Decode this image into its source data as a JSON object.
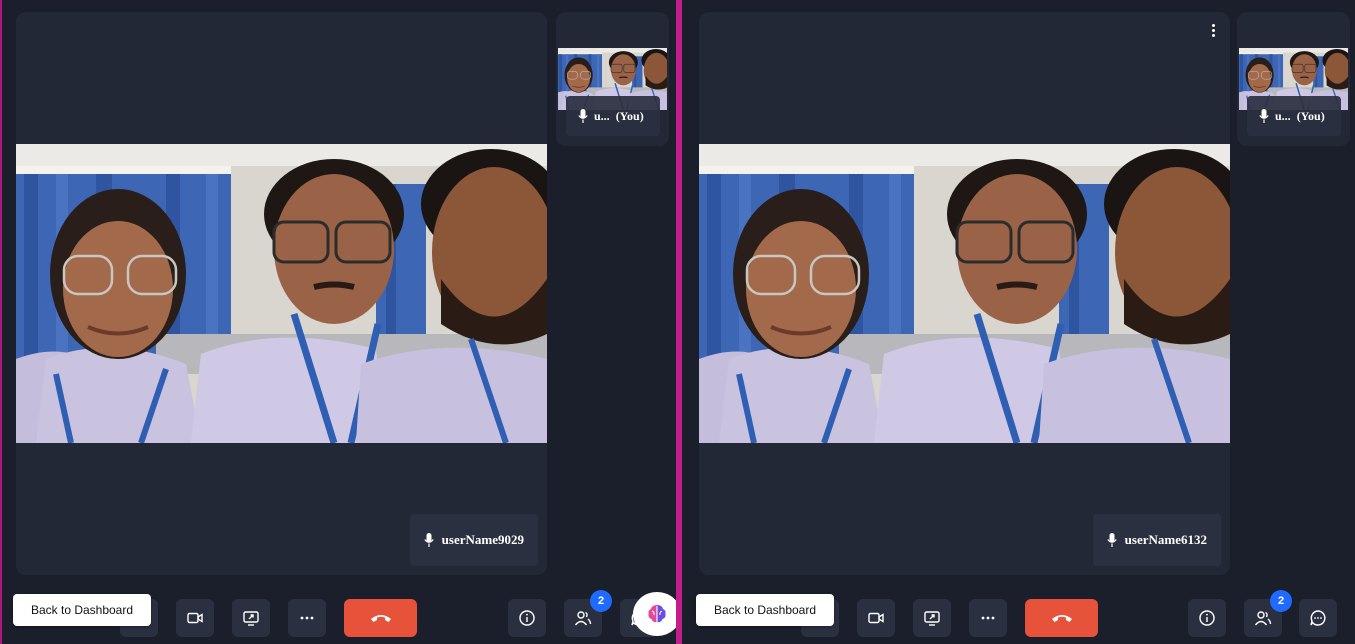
{
  "sessions": [
    {
      "main_participant": "userName9029",
      "self_label": "u...",
      "self_suffix": "(You)",
      "participant_count": "2",
      "back_label": "Back to Dashboard"
    },
    {
      "main_participant": "userName6132",
      "self_label": "u...",
      "self_suffix": "(You)",
      "participant_count": "2",
      "back_label": "Back to Dashboard"
    }
  ],
  "colors": {
    "background": "#1b1f2c",
    "tile": "#232837",
    "end_call": "#e6533a",
    "badge": "#1f6bff",
    "divider": "#c41c8a"
  },
  "icons": [
    "mic-icon",
    "camera-icon",
    "screen-share-icon",
    "more-icon",
    "end-call-icon",
    "info-icon",
    "participants-icon",
    "chat-icon",
    "ai-brain-icon",
    "kebab-icon"
  ]
}
